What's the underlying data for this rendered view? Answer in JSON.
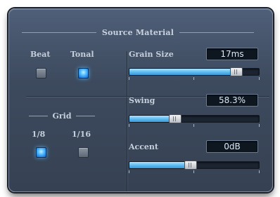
{
  "section": {
    "title": "Source Material"
  },
  "mode": {
    "beat": {
      "label": "Beat",
      "active": false
    },
    "tonal": {
      "label": "Tonal",
      "active": true
    }
  },
  "grid": {
    "title": "Grid",
    "eighth": {
      "label": "1/8",
      "active": true
    },
    "sixteenth": {
      "label": "1/16",
      "active": false
    }
  },
  "grain_size": {
    "label": "Grain Size",
    "value": "17ms",
    "level": 0.86
  },
  "swing": {
    "label": "Swing",
    "value": "58.3%",
    "level": 0.34
  },
  "accent": {
    "label": "Accent",
    "value": "0dB",
    "level": 0.47
  },
  "colors": {
    "led_on": "#4ab6ff",
    "slider_fill": "#5cbaf0",
    "panel": "#3d4a5e"
  }
}
